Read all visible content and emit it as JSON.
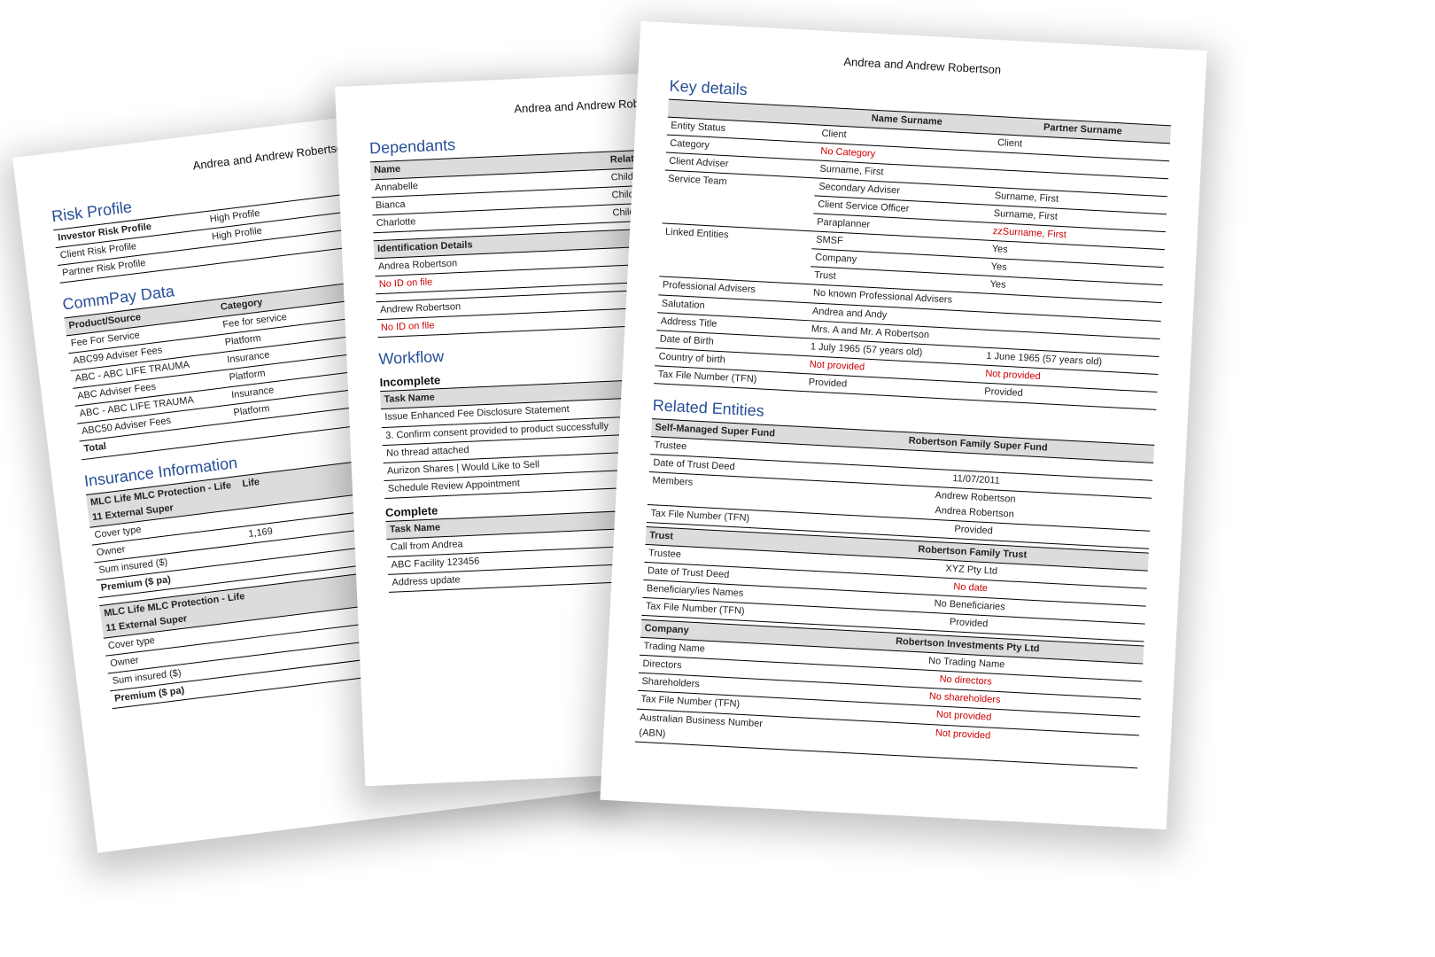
{
  "header_client": "Andrea and Andrew Robertson",
  "page1": {
    "riskprofile_h": "Risk Profile",
    "risk_rows": [
      {
        "label": "Investor Risk Profile",
        "v1": "High Profile",
        "v2": ""
      },
      {
        "label": "Client Risk Profile",
        "v1": "High Profile",
        "v2": ""
      },
      {
        "label": "Partner Risk Profile",
        "v1": "",
        "v2": ""
      }
    ],
    "commpay_h": "CommPay Data",
    "commpay_head": [
      "Product/Source",
      "Category"
    ],
    "commpay_rows": [
      [
        "Fee For Service",
        "Fee for service"
      ],
      [
        "ABC99 Adviser Fees",
        "Platform"
      ],
      [
        "ABC - ABC LIFE TRAUMA",
        "Insurance"
      ],
      [
        "ABC Adviser Fees",
        "Platform"
      ],
      [
        "ABC - ABC LIFE TRAUMA",
        "Insurance"
      ],
      [
        "ABC50 Adviser Fees",
        "Platform"
      ]
    ],
    "commpay_total": "Total",
    "ins_h": "Insurance Information",
    "ins_block_head": "MLC Life MLC Protection - Life 11 External Super",
    "ins_life_col": "Life",
    "ins_rows": [
      [
        "Cover type",
        ""
      ],
      [
        "Owner",
        "1,169"
      ],
      [
        "Sum insured ($)",
        ""
      ]
    ],
    "ins_premium": "Premium ($ pa)"
  },
  "page2": {
    "dep_h": "Dependants",
    "dep_head": [
      "Name",
      "Relation"
    ],
    "dep_rows": [
      [
        "Annabelle",
        "Child"
      ],
      [
        "Bianca",
        "Child"
      ],
      [
        "Charlotte",
        "Child"
      ]
    ],
    "id_head": "Identification Details",
    "id_rows": [
      {
        "name": "Andrea Robertson",
        "note": "No ID on file"
      },
      {
        "name": "Andrew Robertson",
        "note": "No ID on file"
      }
    ],
    "wf_h": "Workflow",
    "incomplete_h": "Incomplete",
    "task_head": "Task Name",
    "incomplete_rows": [
      "Issue Enhanced Fee Disclosure Statement",
      "3. Confirm consent provided to product successfully",
      "No thread attached",
      "Aurizon Shares | Would Like to Sell",
      "Schedule Review Appointment"
    ],
    "complete_h": "Complete",
    "complete_rows": [
      "Call from Andrea",
      "ABC Facility 123456",
      "Address update"
    ]
  },
  "page3": {
    "kd_h": "Key details",
    "kd_head": [
      "Name Surname",
      "Partner Surname"
    ],
    "kd_rows": [
      {
        "label": "Entity Status",
        "v1": "Client",
        "v2": "Client"
      },
      {
        "label": "Category",
        "v1": "No Category",
        "v1_red": true,
        "v2": ""
      },
      {
        "label": "Client Adviser",
        "v1": "Surname, First",
        "v2": ""
      },
      {
        "label": "Service Team",
        "sub": [
          [
            "Secondary Adviser",
            "Surname, First"
          ],
          [
            "Client Service Officer",
            "Surname, First"
          ],
          [
            "Paraplanner",
            "zzSurname, First",
            true
          ]
        ]
      },
      {
        "label": "Linked Entities",
        "sub": [
          [
            "SMSF",
            "Yes"
          ],
          [
            "Company",
            "Yes"
          ],
          [
            "Trust",
            "Yes"
          ]
        ]
      },
      {
        "label": "Professional Advisers",
        "v1": "No known Professional Advisers",
        "span": true
      },
      {
        "label": "Salutation",
        "v1": "Andrea and Andy",
        "span": true
      },
      {
        "label": "Address Title",
        "v1": "Mrs. A and Mr. A Robertson",
        "span": true
      },
      {
        "label": "Date of Birth",
        "v1": "1 July 1965 (57 years old)",
        "v2": "1 June 1965 (57 years old)"
      },
      {
        "label": "Country of birth",
        "v1": "Not provided",
        "v1_red": true,
        "v2": "Not provided",
        "v2_red": true
      },
      {
        "label": "Tax File Number (TFN)",
        "v1": "Provided",
        "v2": "Provided"
      }
    ],
    "re_h": "Related Entities",
    "smsf_head": "Self-Managed Super Fund",
    "smsf_name": "Robertson Family Super Fund",
    "smsf_rows": [
      [
        "Trustee",
        ""
      ],
      [
        "Date of Trust Deed",
        "11/07/2011"
      ],
      [
        "Members",
        "Andrew Robertson\nAndrea Robertson"
      ],
      [
        "Tax File Number (TFN)",
        "Provided"
      ]
    ],
    "trust_head": "Trust",
    "trust_name": "Robertson Family Trust",
    "trust_rows": [
      [
        "Trustee",
        "XYZ Pty Ltd"
      ],
      [
        "Date of Trust Deed",
        "No date",
        true
      ],
      [
        "Beneficiary/ies Names",
        "No Beneficiaries"
      ],
      [
        "Tax File Number (TFN)",
        "Provided"
      ]
    ],
    "company_head": "Company",
    "company_name": "Robertson Investments Pty Ltd",
    "company_rows": [
      [
        "Trading Name",
        "No Trading Name"
      ],
      [
        "Directors",
        "No directors",
        true
      ],
      [
        "Shareholders",
        "No shareholders",
        true
      ],
      [
        "Tax File Number (TFN)",
        "Not provided",
        true
      ],
      [
        "Australian Business Number (ABN)",
        "Not provided",
        true
      ]
    ]
  }
}
